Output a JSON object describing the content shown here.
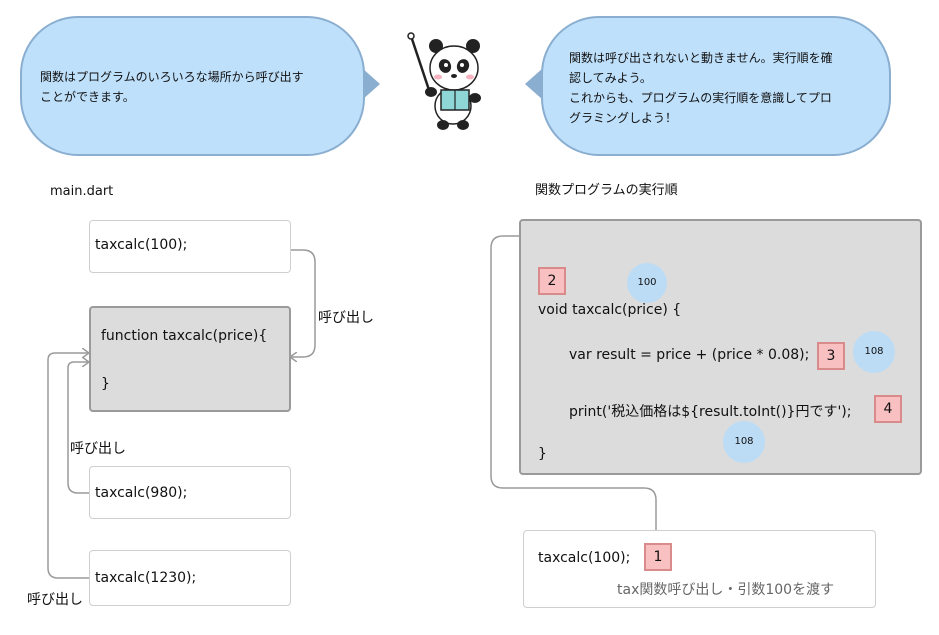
{
  "bubbles": {
    "left_line1": "関数はプログラムのいろいろな場所から呼び出す",
    "left_line2": "ことができます。",
    "right_line1": "関数は呼び出されないと動きません。実行順を確",
    "right_line2": "認してみよう。",
    "right_line3": "これからも、プログラムの実行順を意識してプロ",
    "right_line4": "グラミングしよう！"
  },
  "left_panel": {
    "title": "main.dart",
    "call1": "taxcalc(100);",
    "func_line1": "function taxcalc(price){",
    "func_line2": "}",
    "call2": "taxcalc(980);",
    "call3": "taxcalc(1230);",
    "label_call_1": "呼び出し",
    "label_call_2": "呼び出し",
    "label_call_3": "呼び出し"
  },
  "right_panel": {
    "title": "関数プログラムの実行順",
    "step2": "2",
    "circle_price": "100",
    "line_void": "void taxcalc(price) {",
    "line_var": "var result = price + (price * 0.08);",
    "step3": "3",
    "circle_result": "108",
    "line_print": "print('税込価格は${result.toInt()}円です');",
    "step4": "4",
    "circle_print": "108",
    "line_close": "}",
    "call": "taxcalc(100);",
    "step1": "1",
    "caption": "tax関数呼び出し・引数100を渡す"
  },
  "colors": {
    "bubble_fill": "#bfe0fb",
    "code_box_fill": "#dcdcdc",
    "step_fill": "#f8c0c0",
    "value_circle": "#bcdcf6"
  }
}
